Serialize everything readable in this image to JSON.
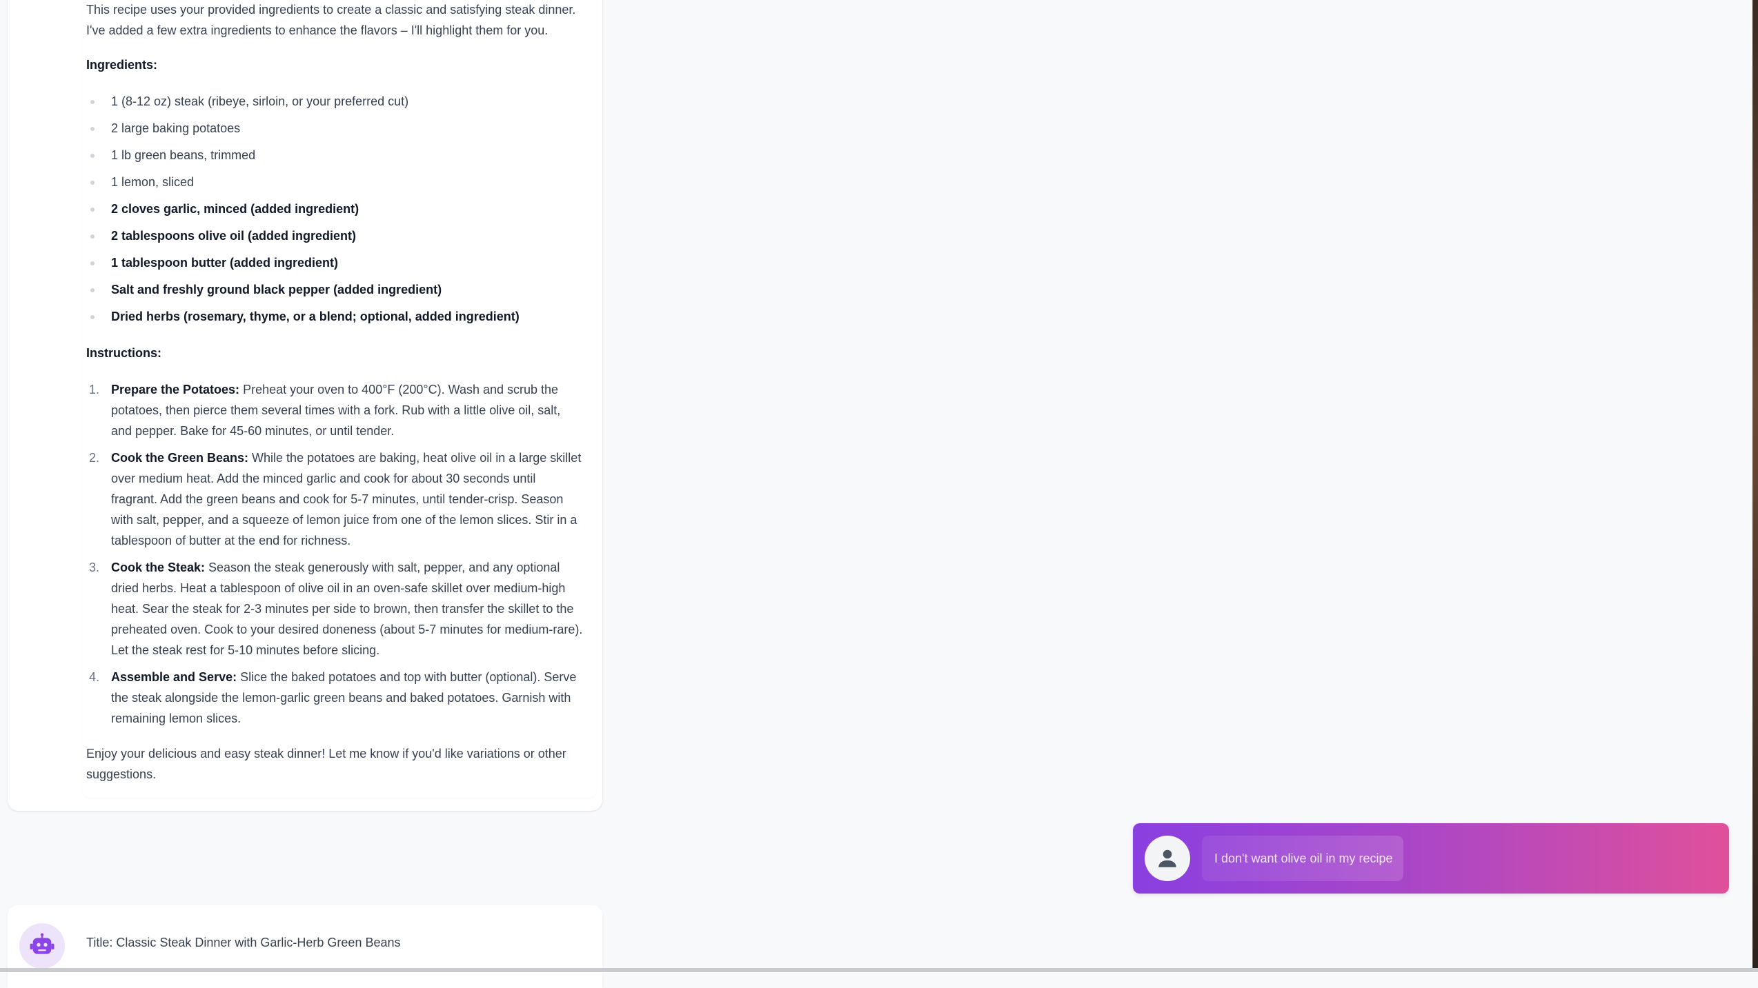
{
  "assistant_message": {
    "intro": "This recipe uses your provided ingredients to create a classic and satisfying steak dinner. I've added a few extra ingredients to enhance the flavors – I'll highlight them for you.",
    "ingredients_heading": "Ingredients:",
    "ingredients": [
      {
        "text": "1 (8-12 oz) steak (ribeye, sirloin, or your preferred cut)",
        "added": false
      },
      {
        "text": "2 large baking potatoes",
        "added": false
      },
      {
        "text": "1 lb green beans, trimmed",
        "added": false
      },
      {
        "text": "1 lemon, sliced",
        "added": false
      },
      {
        "text": "2 cloves garlic, minced (added ingredient)",
        "added": true
      },
      {
        "text": "2 tablespoons olive oil (added ingredient)",
        "added": true
      },
      {
        "text": "1 tablespoon butter (added ingredient)",
        "added": true
      },
      {
        "text": "Salt and freshly ground black pepper (added ingredient)",
        "added": true
      },
      {
        "text": "Dried herbs (rosemary, thyme, or a blend; optional, added ingredient)",
        "added": true
      }
    ],
    "instructions_heading": "Instructions:",
    "steps": [
      {
        "num": "1.",
        "title": "Prepare the Potatoes:",
        "text": " Preheat your oven to 400°F (200°C). Wash and scrub the potatoes, then pierce them several times with a fork. Rub with a little olive oil, salt, and pepper. Bake for 45-60 minutes, or until tender."
      },
      {
        "num": "2.",
        "title": "Cook the Green Beans:",
        "text": " While the potatoes are baking, heat olive oil in a large skillet over medium heat. Add the minced garlic and cook for about 30 seconds until fragrant. Add the green beans and cook for 5-7 minutes, until tender-crisp. Season with salt, pepper, and a squeeze of lemon juice from one of the lemon slices. Stir in a tablespoon of butter at the end for richness."
      },
      {
        "num": "3.",
        "title": "Cook the Steak:",
        "text": " Season the steak generously with salt, pepper, and any optional dried herbs. Heat a tablespoon of olive oil in an oven-safe skillet over medium-high heat. Sear the steak for 2-3 minutes per side to brown, then transfer the skillet to the preheated oven. Cook to your desired doneness (about 5-7 minutes for medium-rare). Let the steak rest for 5-10 minutes before slicing."
      },
      {
        "num": "4.",
        "title": "Assemble and Serve:",
        "text": " Slice the baked potatoes and top with butter (optional). Serve the steak alongside the lemon-garlic green beans and baked potatoes. Garnish with remaining lemon slices."
      }
    ],
    "outro": "Enjoy your delicious and easy steak dinner! Let me know if you'd like variations or other suggestions."
  },
  "user_message": {
    "text": "I don't want olive oil in my recipe",
    "avatar_icon": "user-icon"
  },
  "assistant_message_2": {
    "title_line": "Title: Classic Steak Dinner with Garlic-Herb Green Beans",
    "avatar_icon": "robot-icon"
  },
  "colors": {
    "page_bg": "#f8f9fb",
    "user_gradient_start": "#8a3fe0",
    "user_gradient_end": "#e0509a",
    "bot_avatar_bg": "#ede4fb",
    "bot_avatar_icon": "#8b45e6"
  }
}
